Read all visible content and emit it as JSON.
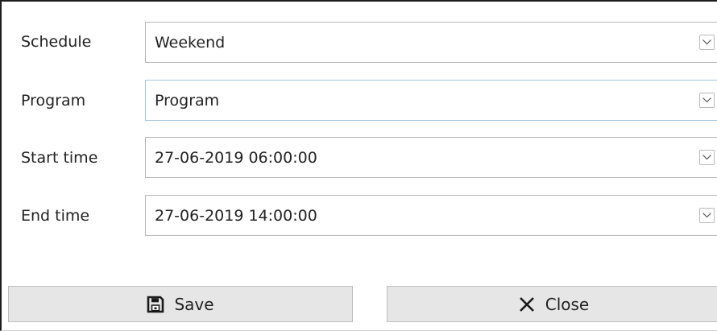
{
  "form": {
    "fields": [
      {
        "label": "Schedule",
        "value": "Weekend",
        "icon": "chevron-down-icon"
      },
      {
        "label": "Program",
        "value": "Program",
        "icon": "chevron-down-icon"
      },
      {
        "label": "Start time",
        "value": "27-06-2019 06:00:00",
        "icon": "chevron-down-icon"
      },
      {
        "label": "End time",
        "value": "27-06-2019 14:00:00",
        "icon": "chevron-down-icon"
      }
    ]
  },
  "actions": {
    "save": {
      "label": "Save",
      "icon": "save-icon"
    },
    "close": {
      "label": "Close",
      "icon": "close-icon"
    }
  },
  "colors": {
    "button_bg": "#e6e6e6",
    "field_border": "#b7b7b7",
    "focus_border": "#a8c6e0"
  }
}
